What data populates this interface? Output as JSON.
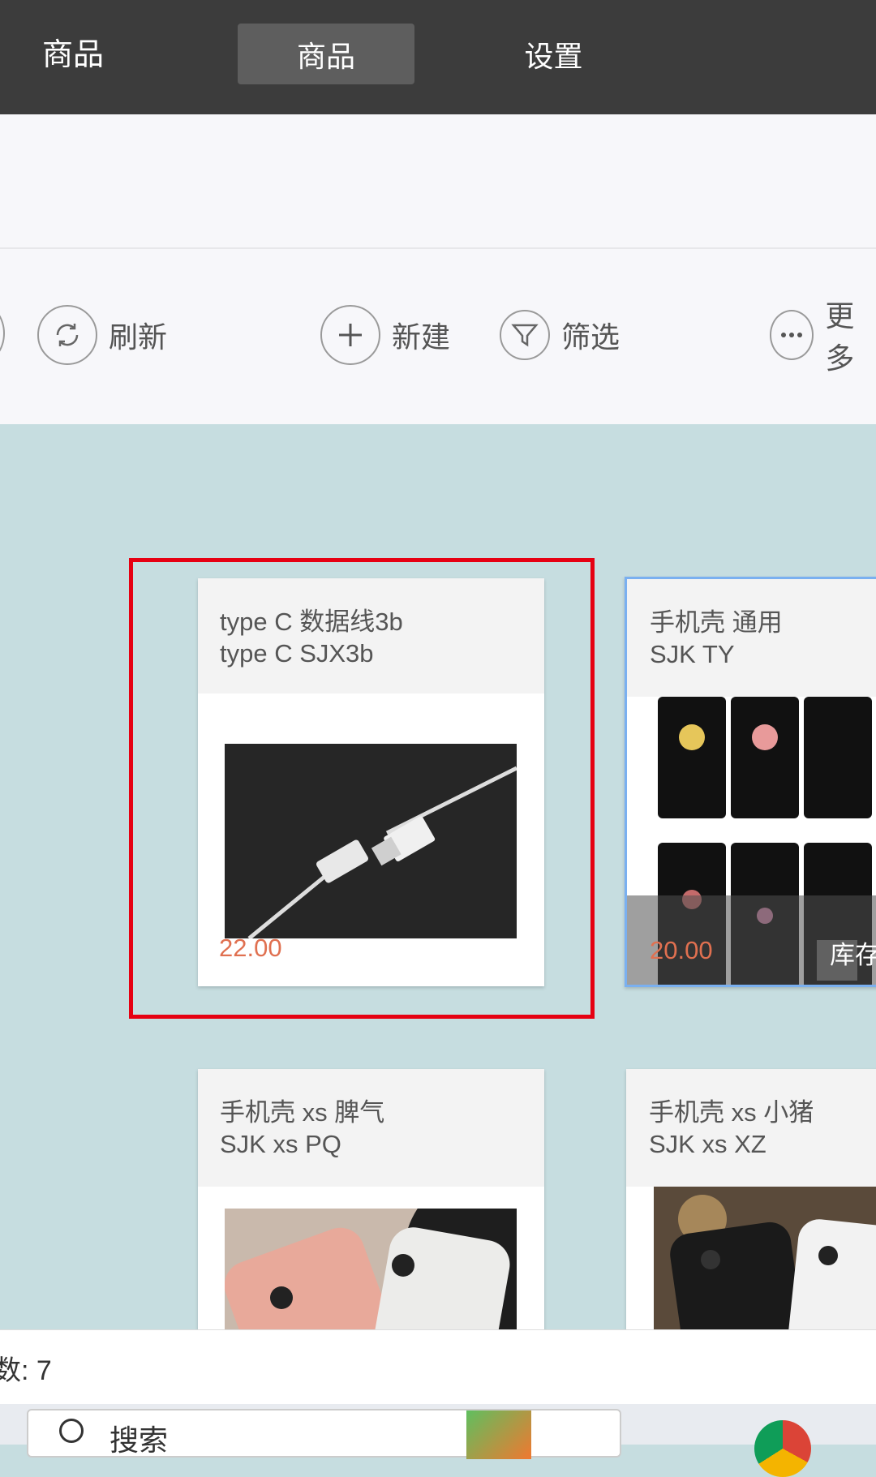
{
  "topbar": {
    "title": "商品",
    "tabs": [
      {
        "label": "商品",
        "active": true
      },
      {
        "label": "设置",
        "active": false
      }
    ]
  },
  "toolbar": {
    "refresh_label": "刷新",
    "new_label": "新建",
    "filter_label": "筛选",
    "more_label": "更多"
  },
  "products": [
    {
      "name": "type C 数据线3b",
      "code": "type C SJX3b",
      "price": "22.00",
      "image": "usb-cable-photo"
    },
    {
      "name": "手机壳 通用",
      "code": "SJK TY",
      "price": "20.00",
      "stock_label": "库存",
      "image": "phone-cases-grid-photo"
    },
    {
      "name": "手机壳 xs 脾气",
      "code": "SJK xs PQ",
      "image": "pink-white-phone-cases-photo"
    },
    {
      "name": "手机壳 xs 小猪",
      "code": "SJK xs XZ",
      "image": "black-white-phone-cases-photo"
    }
  ],
  "status": {
    "count_text": "数: 7"
  },
  "taskbar": {
    "search_label": "搜索"
  },
  "colors": {
    "topbar": "#3c3c3c",
    "content_bg": "#c6dde0",
    "price": "#e07050",
    "highlight": "#e60012"
  }
}
